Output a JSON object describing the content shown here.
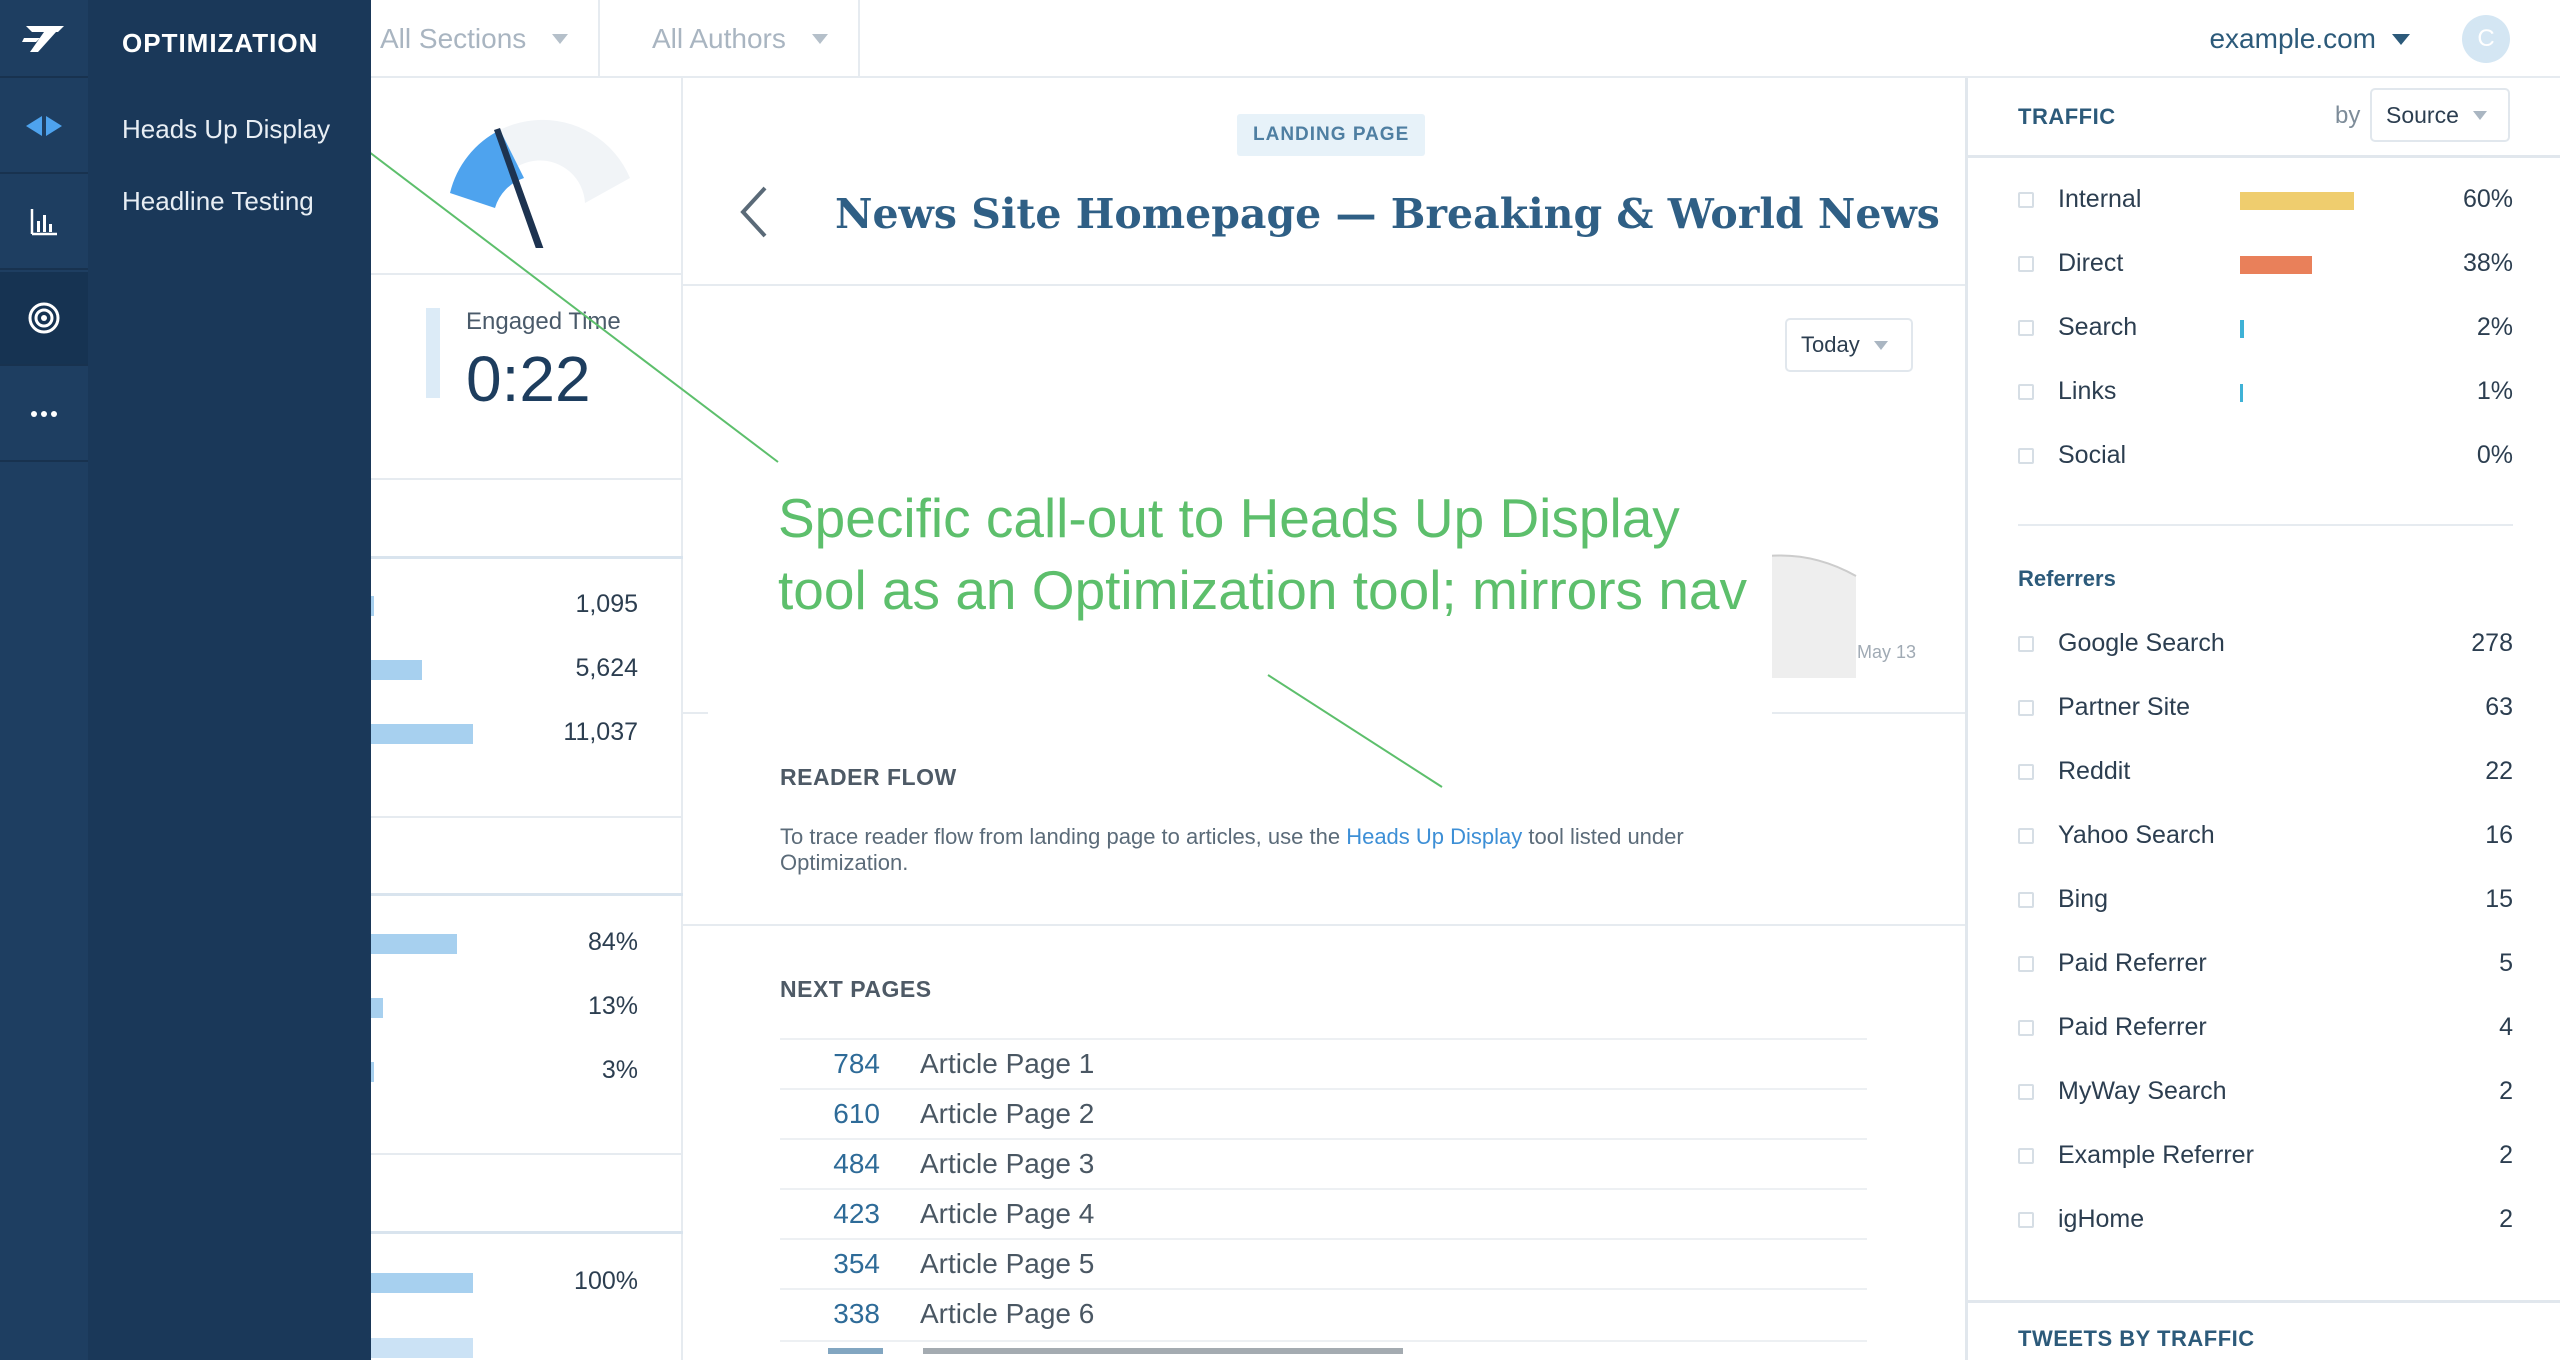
{
  "topbar": {
    "filters": [
      "All Sections",
      "All Authors"
    ],
    "site": "example.com",
    "avatar_initial": "C"
  },
  "nav": {
    "rail_icons": [
      "logo-icon",
      "optimization-icon",
      "bar-chart-icon",
      "target-icon",
      "more-icon"
    ],
    "flyout_title": "OPTIMIZATION",
    "flyout_items": [
      "Heads Up Display",
      "Headline Testing"
    ]
  },
  "left_stats": {
    "engaged_label": "Engaged Time",
    "engaged_value": "0:22",
    "group1": [
      {
        "value": "1,095",
        "fraction": 0.02
      },
      {
        "value": "5,624",
        "fraction": 0.5
      },
      {
        "value": "11,037",
        "fraction": 1.0
      }
    ],
    "group2": [
      {
        "value": "84%",
        "fraction": 0.84
      },
      {
        "value": "13%",
        "fraction": 0.13
      },
      {
        "value": "3%",
        "fraction": 0.03
      }
    ],
    "group3": [
      {
        "value": "100%",
        "fraction": 1.0
      }
    ]
  },
  "main": {
    "badge": "LANDING PAGE",
    "title": "News Site Homepage — Breaking & World News",
    "range_select": "Today",
    "chart_date_label": "May 13",
    "reader_flow": {
      "heading": "READER FLOW",
      "text_before": "To trace reader flow from landing page to articles, use the ",
      "link": "Heads Up Display",
      "text_after": " tool listed under Optimization."
    },
    "next_pages": {
      "heading": "NEXT PAGES",
      "rows": [
        {
          "count": "784",
          "title": "Article Page 1"
        },
        {
          "count": "610",
          "title": "Article Page 2"
        },
        {
          "count": "484",
          "title": "Article Page 3"
        },
        {
          "count": "423",
          "title": "Article Page 4"
        },
        {
          "count": "354",
          "title": "Article Page 5"
        },
        {
          "count": "338",
          "title": "Article Page 6"
        }
      ]
    }
  },
  "traffic": {
    "heading": "TRAFFIC",
    "by_label": "by",
    "by_select": "Source",
    "sources": [
      {
        "label": "Internal",
        "value": "60%",
        "fraction": 0.6,
        "color": "#efcd6e"
      },
      {
        "label": "Direct",
        "value": "38%",
        "fraction": 0.38,
        "color": "#e9805a"
      },
      {
        "label": "Search",
        "value": "2%",
        "fraction": 0.02,
        "color": "#3fb2d6"
      },
      {
        "label": "Links",
        "value": "1%",
        "fraction": 0.01,
        "color": "#3fb2d6"
      },
      {
        "label": "Social",
        "value": "0%",
        "fraction": 0.0,
        "color": "#3fb2d6"
      }
    ],
    "referrers_heading": "Referrers",
    "referrers": [
      {
        "label": "Google Search",
        "value": "278"
      },
      {
        "label": "Partner Site",
        "value": "63"
      },
      {
        "label": "Reddit",
        "value": "22"
      },
      {
        "label": "Yahoo Search",
        "value": "16"
      },
      {
        "label": "Bing",
        "value": "15"
      },
      {
        "label": "Paid Referrer",
        "value": "5"
      },
      {
        "label": "Paid Referrer",
        "value": "4"
      },
      {
        "label": "MyWay Search",
        "value": "2"
      },
      {
        "label": "Example Referrer",
        "value": "2"
      },
      {
        "label": "igHome",
        "value": "2"
      }
    ],
    "tweets_heading": "TWEETS BY TRAFFIC"
  },
  "annotation": {
    "text": "Specific call-out to Heads Up Display tool as an Optimization tool; mirrors nav",
    "color": "#5dbf6c"
  }
}
